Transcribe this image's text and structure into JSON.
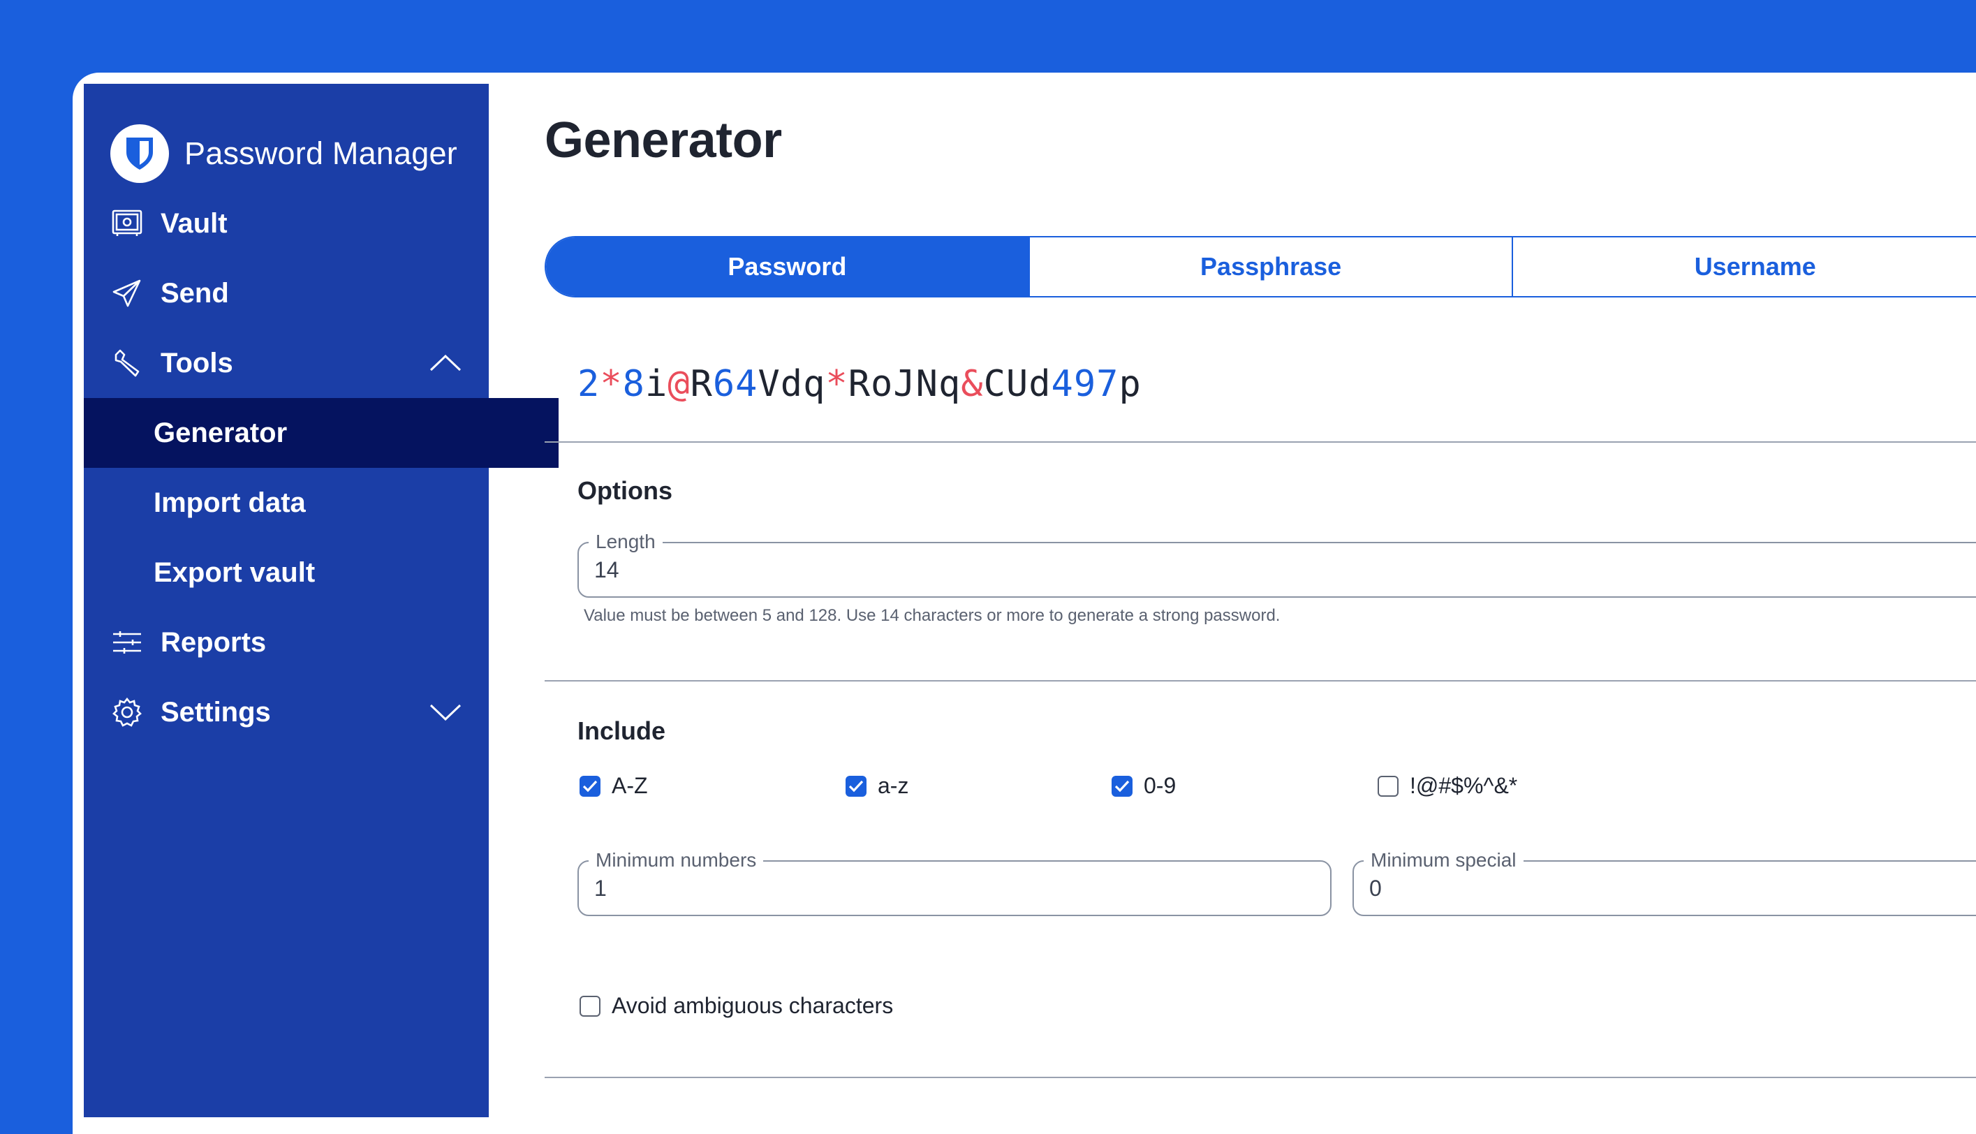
{
  "app": {
    "name": "Password Manager"
  },
  "sidebar": {
    "items": [
      {
        "label": "Vault",
        "icon": "vault-icon"
      },
      {
        "label": "Send",
        "icon": "send-icon"
      },
      {
        "label": "Tools",
        "icon": "wrench-icon",
        "expanded": true
      },
      {
        "label": "Generator",
        "active": true
      },
      {
        "label": "Import data"
      },
      {
        "label": "Export vault"
      },
      {
        "label": "Reports",
        "icon": "sliders-icon"
      },
      {
        "label": "Settings",
        "icon": "gear-icon",
        "expanded": false
      }
    ]
  },
  "page": {
    "title": "Generator"
  },
  "tabs": [
    {
      "label": "Password",
      "selected": true
    },
    {
      "label": "Passphrase",
      "selected": false
    },
    {
      "label": "Username",
      "selected": false
    }
  ],
  "generated_password": {
    "value": "2*8i@R64Vdq*RoJNq&CUd497p",
    "parts": [
      "2",
      "*",
      "8",
      "i",
      "@",
      "R",
      "64",
      "Vdq",
      "*",
      "RoJNq",
      "&",
      "CUd",
      "497",
      "p"
    ]
  },
  "options": {
    "title": "Options",
    "length": {
      "label": "Length",
      "value": "14",
      "hint": "Value must be between 5 and 128. Use 14 characters or more to generate a strong password."
    }
  },
  "include": {
    "title": "Include",
    "checkboxes": [
      {
        "label": "A-Z",
        "checked": true
      },
      {
        "label": "a-z",
        "checked": true
      },
      {
        "label": "0-9",
        "checked": true
      },
      {
        "label": "!@#$%^&*",
        "checked": false
      }
    ],
    "minimum_numbers": {
      "label": "Minimum numbers",
      "value": "1"
    },
    "minimum_special": {
      "label": "Minimum special",
      "value": "0"
    },
    "avoid_ambiguous": {
      "label": "Avoid ambiguous characters",
      "checked": false
    }
  },
  "colors": {
    "brand_blue": "#1a5fdd",
    "sidebar": "#1b3ea7",
    "sidebar_active": "#05135f",
    "password_number": "#1a5fdd",
    "password_symbol": "#ea4d5b"
  }
}
